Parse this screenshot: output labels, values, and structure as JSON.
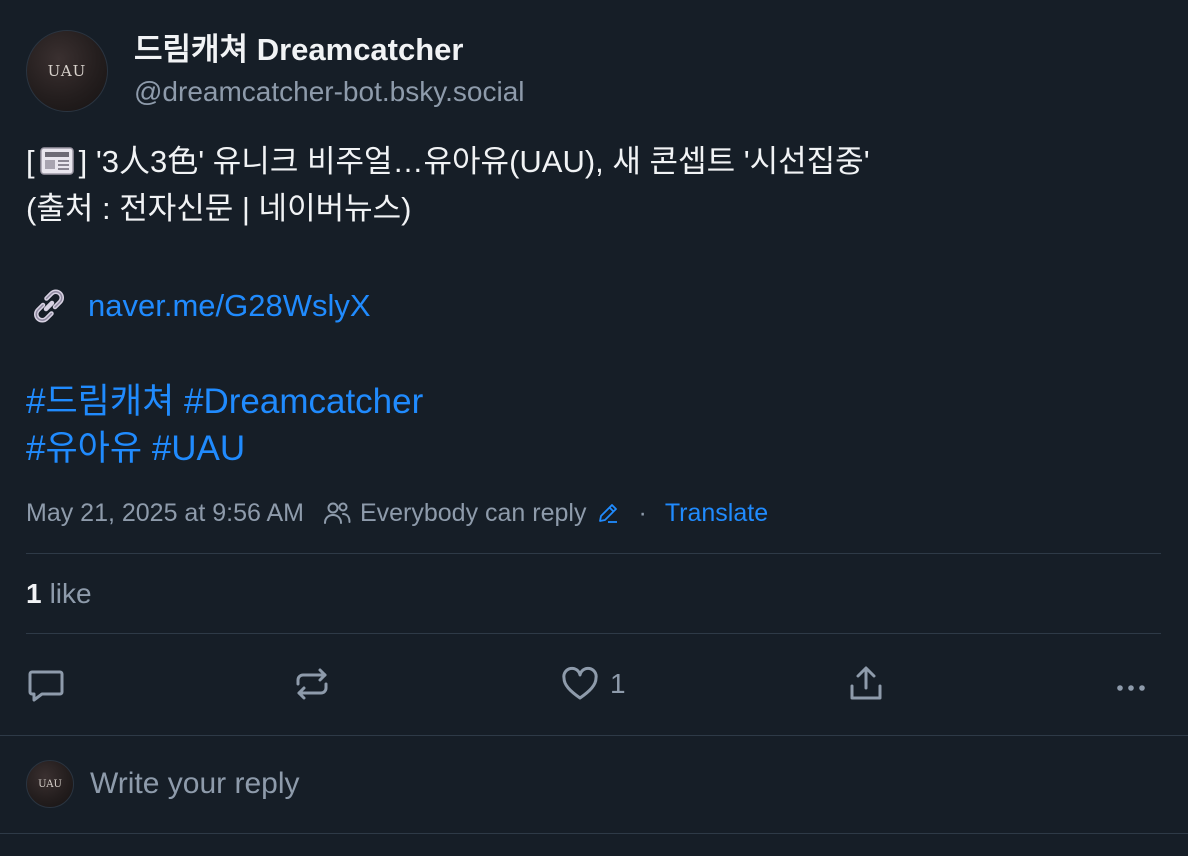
{
  "author": {
    "display_name": "드림캐쳐 Dreamcatcher",
    "handle": "@dreamcatcher-bot.bsky.social",
    "avatar_text": "UAU"
  },
  "post": {
    "line1_open": "[",
    "line1_text": "] '3人3色' 유니크 비주얼…유아유(UAU), 새 콘셉트 '시선집중'",
    "line2_text": "(출처 : 전자신문 | 네이버뉴스)",
    "link_text": "naver.me/G28WslyX",
    "hashtags_line1": [
      "#드림캐쳐",
      "#Dreamcatcher"
    ],
    "hashtags_line2": [
      "#유아유",
      "#UAU"
    ]
  },
  "meta": {
    "timestamp": "May 21, 2025 at 9:56 AM",
    "reply_setting": "Everybody can reply",
    "separator": "·",
    "translate_label": "Translate"
  },
  "stats": {
    "like_count": "1",
    "like_label": "like"
  },
  "actions": {
    "like_count": "1",
    "icons": [
      "reply-icon",
      "repost-icon",
      "like-icon",
      "share-icon",
      "more-icon"
    ]
  },
  "reply": {
    "placeholder": "Write your reply",
    "avatar_text": "UAU"
  },
  "colors": {
    "background": "#161e27",
    "accent": "#208bfe",
    "muted": "#8e9bab",
    "divider": "#2e3a47"
  }
}
